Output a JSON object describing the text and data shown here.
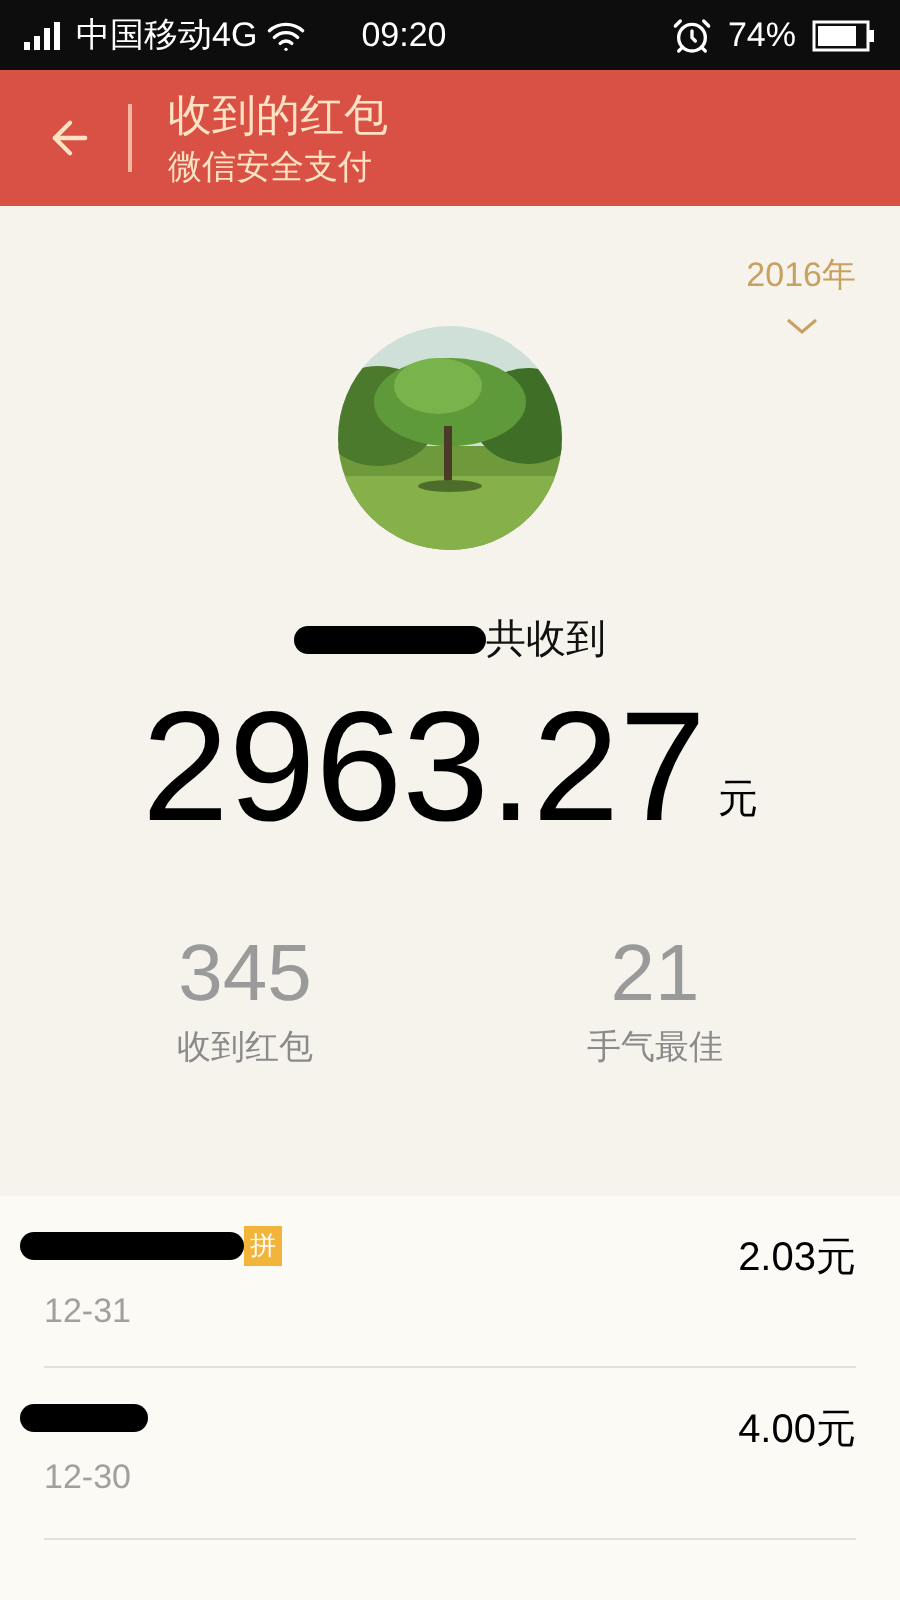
{
  "status_bar": {
    "carrier": "中国移动4G",
    "time": "09:20",
    "battery": "74%"
  },
  "header": {
    "title": "收到的红包",
    "subtitle": "微信安全支付"
  },
  "year_picker": {
    "label": "2016年"
  },
  "summary": {
    "suffix": "共收到",
    "amount": "2963.27",
    "unit": "元"
  },
  "stats": [
    {
      "value": "345",
      "label": "收到红包"
    },
    {
      "value": "21",
      "label": "手气最佳"
    }
  ],
  "records": [
    {
      "date": "12-31",
      "amount": "2.03元",
      "badge": "拼"
    },
    {
      "date": "12-30",
      "amount": "4.00元"
    }
  ]
}
